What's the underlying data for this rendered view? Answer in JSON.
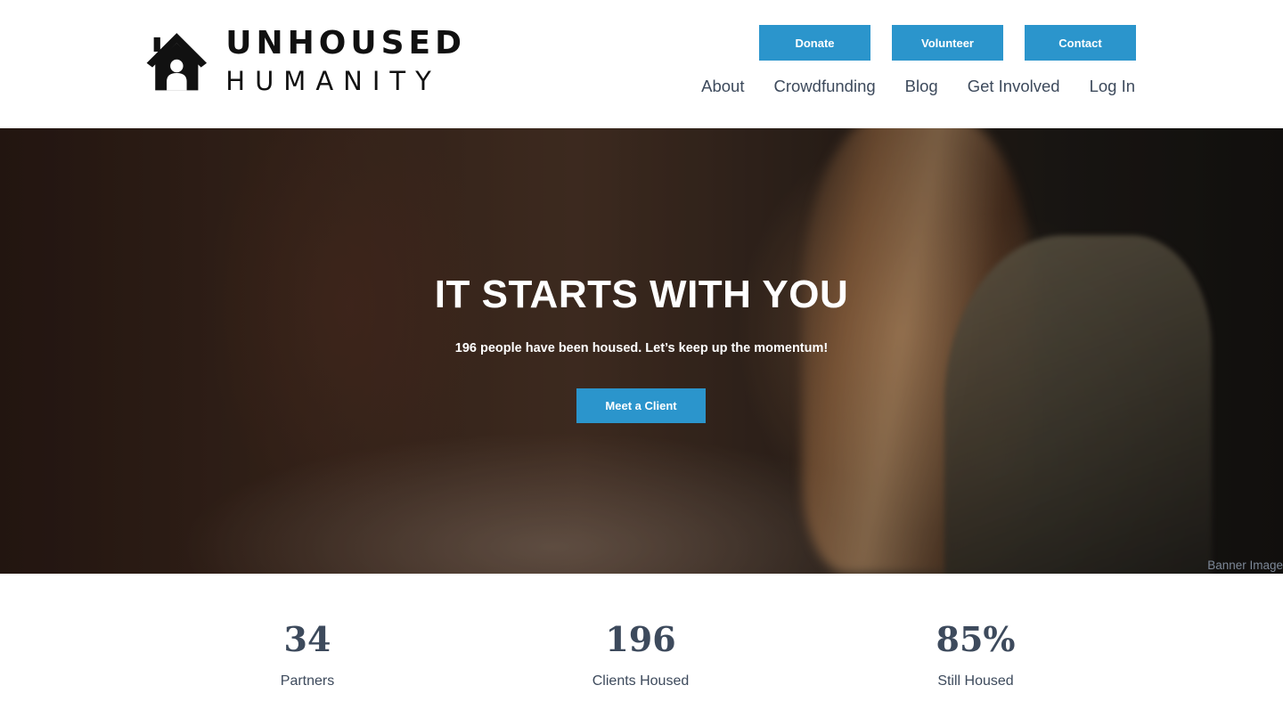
{
  "logo": {
    "line1": "UNHOUSED",
    "line2": "HUMANITY",
    "icon": "house-icon"
  },
  "top_buttons": {
    "donate": "Donate",
    "volunteer": "Volunteer",
    "contact": "Contact"
  },
  "nav": [
    {
      "label": "About"
    },
    {
      "label": "Crowdfunding"
    },
    {
      "label": "Blog"
    },
    {
      "label": "Get Involved"
    },
    {
      "label": "Log In"
    }
  ],
  "hero": {
    "title": "IT STARTS WITH YOU",
    "subtitle": "196 people have been housed. Let’s keep up the momentum!",
    "button": "Meet a Client",
    "caption": "Banner Image"
  },
  "stats": [
    {
      "value": "34",
      "label": "Partners"
    },
    {
      "value": "196",
      "label": "Clients Housed"
    },
    {
      "value": "85%",
      "label": "Still Housed"
    }
  ],
  "colors": {
    "accent": "#2b95cc",
    "text": "#3d4a5c"
  }
}
